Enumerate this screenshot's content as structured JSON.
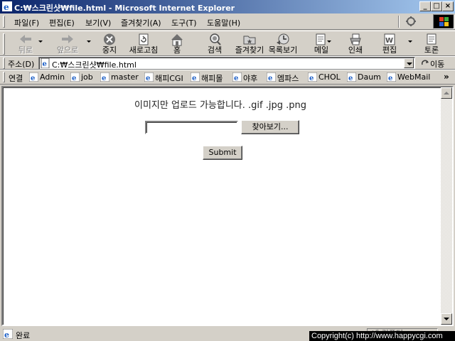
{
  "window": {
    "title": "C:₩스크린샷₩file.html - Microsoft Internet Explorer",
    "controls": {
      "minimize": "_",
      "maximize": "□",
      "close": "×"
    }
  },
  "menu": {
    "items": [
      "파일(F)",
      "편집(E)",
      "보기(V)",
      "즐겨찾기(A)",
      "도구(T)",
      "도움말(H)"
    ]
  },
  "toolbar": {
    "back": "뒤로",
    "forward": "앞으로",
    "stop": "중지",
    "refresh": "새로고침",
    "home": "홈",
    "search": "검색",
    "favorites": "즐겨찾기",
    "history": "목록보기",
    "mail": "메일",
    "print": "인쇄",
    "edit": "편집",
    "discuss": "토론"
  },
  "address": {
    "label": "주소(D)",
    "value": "C:₩스크린샷₩file.html",
    "go_label": "이동"
  },
  "links": {
    "label": "연결",
    "items": [
      "Admin",
      "job",
      "master",
      "해피CGI",
      "해피몰",
      "야후",
      "엠파스",
      "CHOL",
      "Daum",
      "WebMail"
    ],
    "more": "»"
  },
  "page": {
    "notice": "이미지만 업로드 가능합니다. .gif .jpg .png",
    "file_value": "",
    "browse_label": "찾아보기...",
    "submit_label": "Submit"
  },
  "status": {
    "text": "완료",
    "zone": "내 컴퓨터",
    "copyright": "Copyright(c) http://www.happycgi.com"
  },
  "colors": {
    "titlebar_start": "#0a246a",
    "titlebar_end": "#a6caf0",
    "chrome": "#d4d0c8",
    "content_bg": "#ffffff"
  }
}
